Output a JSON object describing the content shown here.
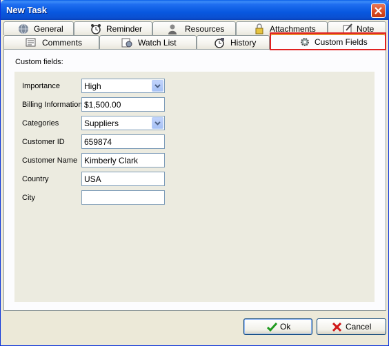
{
  "window": {
    "title": "New Task"
  },
  "tabs_row1": [
    {
      "label": "General",
      "icon": "globe-icon"
    },
    {
      "label": "Reminder",
      "icon": "alarm-clock-icon"
    },
    {
      "label": "Resources",
      "icon": "person-icon"
    },
    {
      "label": "Attachments",
      "icon": "lock-icon"
    },
    {
      "label": "Note",
      "icon": "note-icon"
    }
  ],
  "tabs_row2": [
    {
      "label": "Comments",
      "icon": "comments-icon"
    },
    {
      "label": "Watch List",
      "icon": "watch-list-icon"
    },
    {
      "label": "History",
      "icon": "history-icon"
    },
    {
      "label": "Custom Fields",
      "icon": "gear-icon",
      "active": true
    }
  ],
  "panel": {
    "section_label": "Custom fields:",
    "fields": [
      {
        "label": "Importance",
        "value": "High",
        "type": "combo"
      },
      {
        "label": "Billing Information",
        "value": "$1,500.00",
        "type": "text"
      },
      {
        "label": "Categories",
        "value": "Suppliers",
        "type": "combo"
      },
      {
        "label": "Customer ID",
        "value": "659874",
        "type": "text"
      },
      {
        "label": "Customer Name",
        "value": "Kimberly Clark",
        "type": "text"
      },
      {
        "label": "Country",
        "value": "USA",
        "type": "text"
      },
      {
        "label": "City",
        "value": "",
        "type": "text"
      }
    ]
  },
  "buttons": {
    "ok": "Ok",
    "cancel": "Cancel"
  },
  "colors": {
    "title_bar": "#0a5fe8",
    "highlight": "#e02020",
    "active_tab_accent": "#e68b2c"
  }
}
